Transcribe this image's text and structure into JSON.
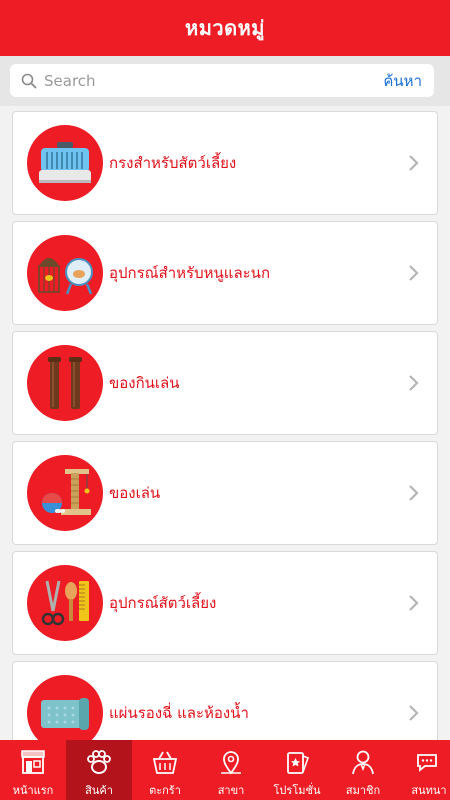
{
  "header": {
    "title": "หมวดหมู่"
  },
  "search": {
    "placeholder": "Search",
    "button_label": "ค้นหา"
  },
  "categories": [
    {
      "label": "กรงสำหรับสัตว์เลี้ยง",
      "icon": "pet-carrier-icon"
    },
    {
      "label": "อุปกรณ์สำหรับหนูและนก",
      "icon": "birdcage-hamster-wheel-icon"
    },
    {
      "label": "ของกินเล่น",
      "icon": "chew-sticks-icon"
    },
    {
      "label": "ของเล่น",
      "icon": "cat-tree-ball-icon"
    },
    {
      "label": "อุปกรณ์สัตว์เลี้ยง",
      "icon": "grooming-tools-icon"
    },
    {
      "label": "แผ่นรองฉี่ และห้องน้ำ",
      "icon": "pee-pad-icon"
    }
  ],
  "tabs": [
    {
      "label": "หน้าแรก",
      "icon": "storefront-icon",
      "active": false
    },
    {
      "label": "สินค้า",
      "icon": "paw-icon",
      "active": true
    },
    {
      "label": "ตะกร้า",
      "icon": "basket-icon",
      "active": false
    },
    {
      "label": "สาขา",
      "icon": "map-pin-icon",
      "active": false
    },
    {
      "label": "โปรโมชั่น",
      "icon": "promo-cards-icon",
      "active": false
    },
    {
      "label": "สมาชิก",
      "icon": "member-icon",
      "active": false
    },
    {
      "label": "สนทนา",
      "icon": "chat-icon",
      "active": false
    }
  ],
  "colors": {
    "brand_red": "#ee1c25",
    "active_tab": "#b3141b",
    "link_blue": "#1a6fd6"
  }
}
